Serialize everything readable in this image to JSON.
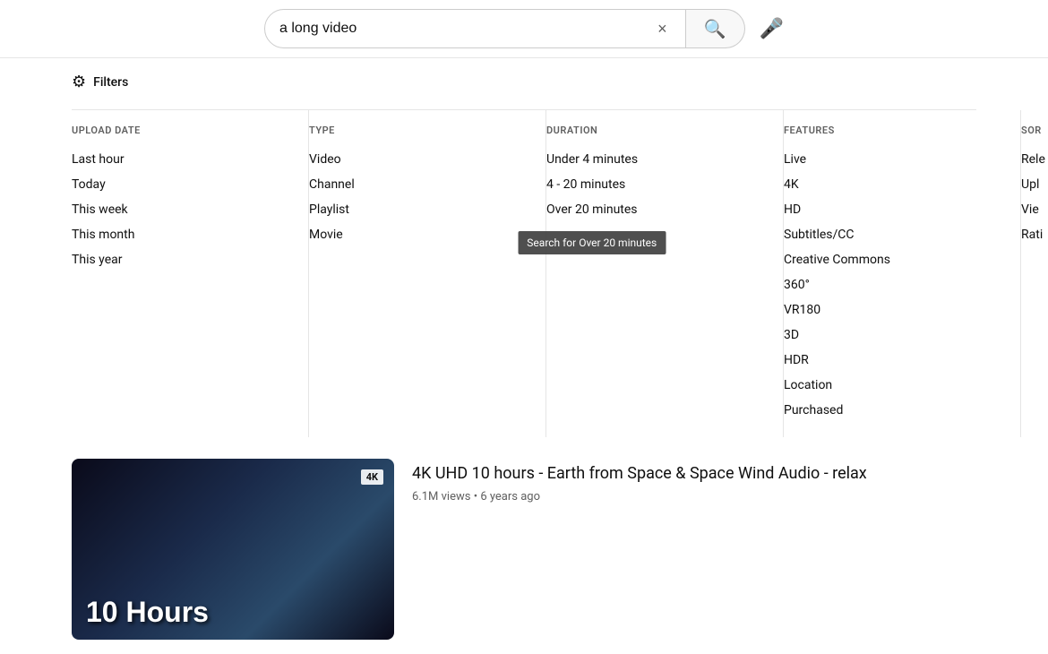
{
  "header": {
    "search_value": "a long video",
    "clear_label": "×",
    "search_icon": "🔍",
    "mic_icon": "🎤"
  },
  "filters": {
    "toggle_label": "Filters",
    "columns": [
      {
        "id": "upload_date",
        "header": "UPLOAD DATE",
        "items": [
          "Last hour",
          "Today",
          "This week",
          "This month",
          "This year"
        ]
      },
      {
        "id": "type",
        "header": "TYPE",
        "items": [
          "Video",
          "Channel",
          "Playlist",
          "Movie"
        ]
      },
      {
        "id": "duration",
        "header": "DURATION",
        "items": [
          "Under 4 minutes",
          "4 - 20 minutes",
          "Over 20 minutes"
        ]
      },
      {
        "id": "features",
        "header": "FEATURES",
        "items": [
          "Live",
          "4K",
          "HD",
          "Subtitles/CC",
          "Creative Commons",
          "360°",
          "VR180",
          "3D",
          "HDR",
          "Location",
          "Purchased"
        ]
      },
      {
        "id": "sort",
        "header": "SOR",
        "items": [
          "Rele",
          "Upl",
          "Vie",
          "Rati"
        ]
      }
    ],
    "tooltip": "Search for Over 20 minutes"
  },
  "results": [
    {
      "id": "result-1",
      "thumbnail_text": "10 Hours",
      "thumbnail_badge": "4K",
      "title": "4K UHD 10 hours - Earth from Space & Space Wind Audio - relax",
      "views": "6.1M views",
      "age": "6 years ago"
    }
  ]
}
